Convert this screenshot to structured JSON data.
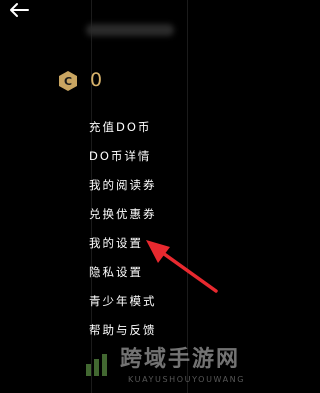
{
  "coin": {
    "count": "0"
  },
  "menu": {
    "items": [
      {
        "label": "充值DO币"
      },
      {
        "label": "DO币详情"
      },
      {
        "label": "我的阅读券"
      },
      {
        "label": "兑换优惠券"
      },
      {
        "label": "我的设置"
      },
      {
        "label": "隐私设置"
      },
      {
        "label": "青少年模式"
      },
      {
        "label": "帮助与反馈"
      }
    ]
  },
  "watermark": {
    "title": "跨域手游网",
    "subtitle": "KUAYUSHOUYOUWANG"
  },
  "colors": {
    "background": "#000000",
    "accent_gold": "#d8b36c",
    "annotation_arrow": "#e8292f"
  }
}
